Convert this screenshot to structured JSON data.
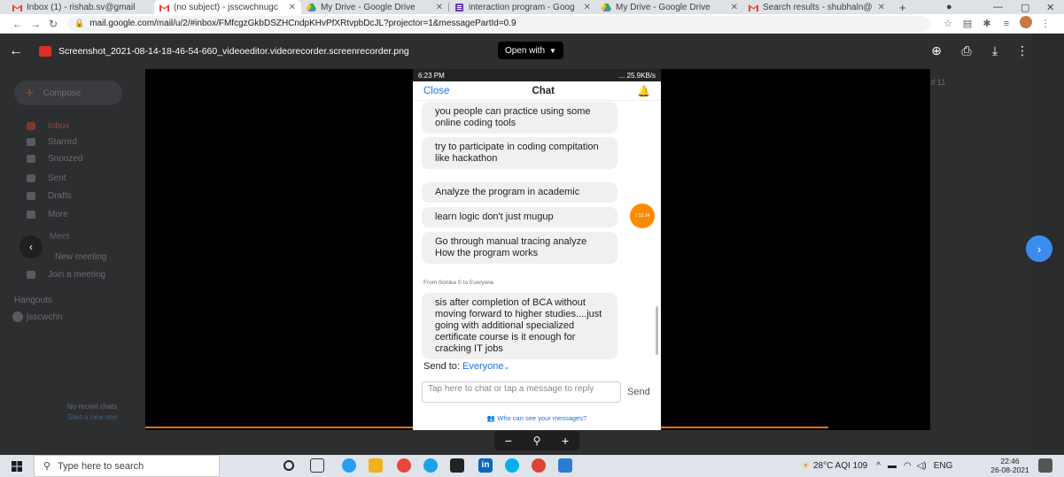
{
  "browser": {
    "tabs": [
      {
        "title": "Inbox (1) - rishab.sv@gmail",
        "icon": "gmail-icon",
        "active": false
      },
      {
        "title": "(no subject) - jsscwchnugc",
        "icon": "gmail-icon",
        "active": true
      },
      {
        "title": "My Drive - Google Drive",
        "icon": "drive-icon",
        "active": false
      },
      {
        "title": "interaction program - Goog",
        "icon": "forms-icon",
        "active": false
      },
      {
        "title": "My Drive - Google Drive",
        "icon": "drive-icon",
        "active": false
      },
      {
        "title": "Search results - shubhaln@",
        "icon": "gmail-icon",
        "active": false
      }
    ],
    "new_tab": "+",
    "url": "mail.google.com/mail/u/2/#inbox/FMfcgzGkbDSZHCndpKHvPfXRtvpbDcJL?projector=1&messagePartId=0.9"
  },
  "gmail": {
    "compose": "Compose",
    "nav": [
      {
        "label": "Inbox",
        "icon": "inbox-icon"
      },
      {
        "label": "Starred",
        "icon": "star-icon"
      },
      {
        "label": "Snoozed",
        "icon": "clock-icon"
      },
      {
        "label": "Sent",
        "icon": "send-icon"
      },
      {
        "label": "Drafts",
        "icon": "draft-icon"
      },
      {
        "label": "More",
        "icon": "chevron-down-icon"
      }
    ],
    "meet_title": "Meet",
    "meet": [
      "New meeting",
      "Join a meeting"
    ],
    "hangouts_title": "Hangouts",
    "hangouts_user": "jsscwchn",
    "no_chats": "No recent chats",
    "start_chat": "Start a new one",
    "pagination": "of 11"
  },
  "viewer": {
    "filename": "Screenshot_2021-08-14-18-46-54-660_videoeditor.videorecorder.screenrecorder.png",
    "open_with": "Open with",
    "zoom_out": "−",
    "zoom_in": "+",
    "video_progress": 0.87
  },
  "phone": {
    "time": "6:23 PM",
    "status_right": "... 25.9KB/s",
    "close": "Close",
    "title": "Chat",
    "messages": [
      "you people can practice using some online coding tools",
      "try to participate in coding compitation like hackathon",
      "Analyze the program in academic",
      "learn logic don't just mugup",
      "Go through manual tracing analyze How the program works",
      "sis after completion of BCA without moving forward to higher studies....just going with additional specialized certificate course is  it enough for cracking IT  jobs"
    ],
    "from_line": "From Sonika S to Everyone",
    "send_to_label": "Send to:",
    "send_to_target": "Everyone",
    "input_placeholder": "Tap here to chat or tap a message to reply",
    "send": "Send",
    "who_can_see": "Who can see your messages?",
    "timer": "1:13:14"
  },
  "taskbar": {
    "search_placeholder": "Type here to search",
    "weather": "28°C  AQI 109",
    "language": "ENG",
    "time": "22:46",
    "date": "26-08-2021"
  },
  "colors": {
    "accent": "#1a73e8",
    "progress": "#e8710a",
    "timer": "#ff8a00"
  }
}
